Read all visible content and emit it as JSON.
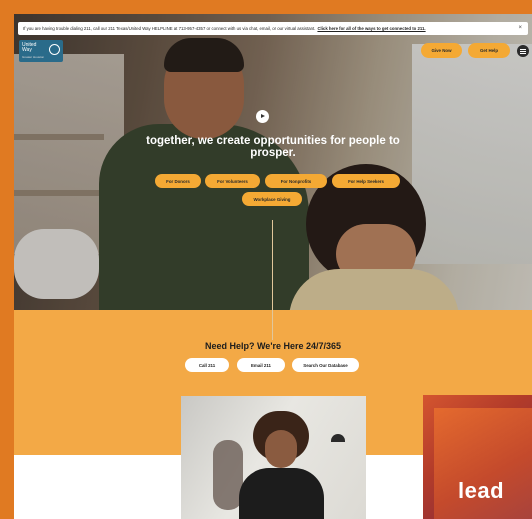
{
  "alert": {
    "text": "If you are having trouble dialing 211, call our 211 Texas/United Way HELPLINE at 713-957-4357 or connect with us via chat, email, or our virtual assistant.",
    "link": "Click here for all of the ways to get connected to 211.",
    "close": "×"
  },
  "header": {
    "logo_line1": "United",
    "logo_line2": "Way",
    "logo_sub": "Greater Houston",
    "give_now": "Give Now",
    "get_help": "Get Help"
  },
  "hero": {
    "title": "together, we create opportunities for people to prosper.",
    "buttons": [
      "For Donors",
      "For Volunteers",
      "For Nonprofits",
      "For Help Seekers"
    ],
    "workplace": "Workplace Giving"
  },
  "help": {
    "title": "Need Help? We're Here 24/7/365",
    "buttons": [
      "Call 211",
      "Email 211",
      "Search Our Database"
    ]
  },
  "promo": {
    "text": "lead"
  },
  "colors": {
    "accent": "#f4a934",
    "help_bg": "#f3a946",
    "frame": "#e07a22"
  }
}
